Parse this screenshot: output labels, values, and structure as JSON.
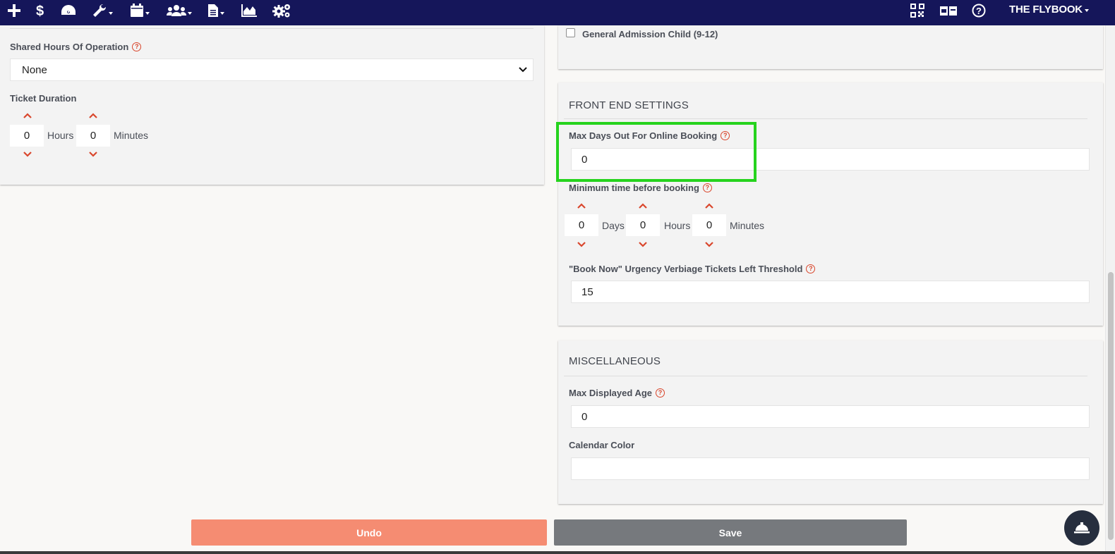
{
  "nav": {
    "icons": [
      "plus-icon",
      "dollar-icon",
      "dashboard-gauge-icon",
      "wrench-icon",
      "calendar-icon",
      "users-icon",
      "document-icon",
      "area-chart-icon",
      "gears-icon",
      "qr-code-icon",
      "ticket-icon",
      "help-circle-icon"
    ],
    "brand": "THE FLYBOOK"
  },
  "left": {
    "shared_hours_label": "Shared Hours Of Operation",
    "shared_hours_value": "None",
    "ticket_duration_label": "Ticket Duration",
    "duration_hours": "0",
    "hours_unit": "Hours",
    "duration_minutes": "0",
    "minutes_unit": "Minutes"
  },
  "right": {
    "checkbox_label": "General Admission Child (9-12)",
    "front_end": {
      "title": "FRONT END SETTINGS",
      "max_days_label": "Max Days Out For Online Booking",
      "max_days_value": "0",
      "min_time_label": "Minimum time before booking",
      "days_value": "0",
      "days_unit": "Days",
      "hours_value": "0",
      "hours_unit": "Hours",
      "minutes_value": "0",
      "minutes_unit": "Minutes",
      "urgency_label": "\"Book Now\" Urgency Verbiage Tickets Left Threshold",
      "urgency_value": "15"
    },
    "misc": {
      "title": "MISCELLANEOUS",
      "max_age_label": "Max Displayed Age",
      "max_age_value": "0",
      "calendar_color_label": "Calendar Color",
      "calendar_color_value": ""
    }
  },
  "footer": {
    "undo_label": "Undo",
    "save_label": "Save"
  },
  "colors": {
    "nav_bg": "#15165a",
    "accent_red": "#d9462c",
    "undo_bg": "#f58c72",
    "save_bg": "#76797d",
    "highlight": "#26d31e"
  }
}
